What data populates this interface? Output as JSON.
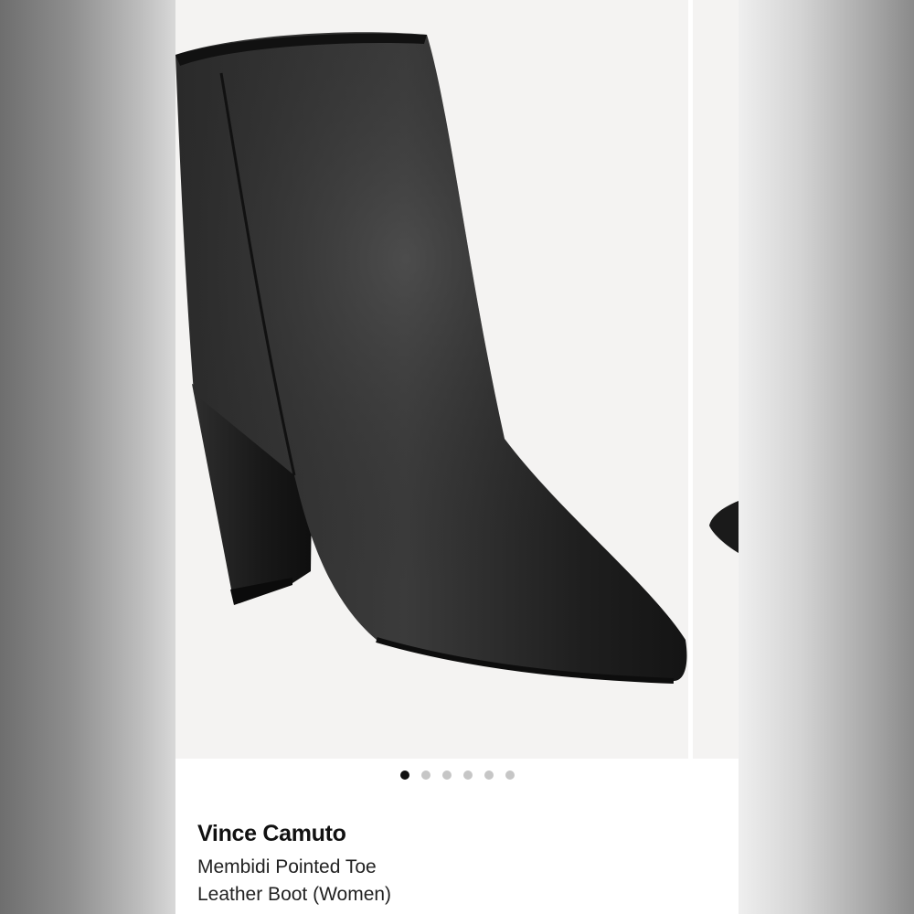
{
  "product": {
    "brand": "Vince Camuto",
    "name_line1": "Membidi Pointed Toe",
    "name_line2": "Leather Boot (Women)"
  },
  "gallery": {
    "image_count": 6,
    "active_index": 0,
    "image_subject": "black-leather-ankle-boot"
  },
  "colors": {
    "boot": "#1c1c1c",
    "dot_active": "#111111",
    "dot_inactive": "#c6c6c6",
    "image_bg": "#f4f3f2"
  }
}
